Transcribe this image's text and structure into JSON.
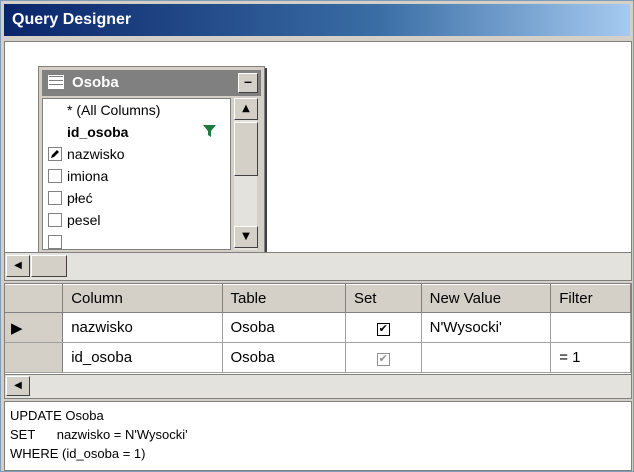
{
  "window": {
    "title": "Query Designer"
  },
  "diagram": {
    "table_name": "Osoba",
    "minimize_symbol": "–",
    "columns": [
      {
        "label": "* (All Columns)",
        "bold": false,
        "checked": false
      },
      {
        "label": "id_osoba",
        "bold": true,
        "checked": false,
        "filter": true
      },
      {
        "label": "nazwisko",
        "bold": false,
        "checked": true
      },
      {
        "label": "imiona",
        "bold": false,
        "checked": false
      },
      {
        "label": "płeć",
        "bold": false,
        "checked": false
      },
      {
        "label": "pesel",
        "bold": false,
        "checked": false
      }
    ],
    "icons": {
      "filter": "filter-icon",
      "scroll_up": "arrow-up-icon",
      "scroll_down": "arrow-down-icon",
      "scroll_left": "arrow-left-icon"
    }
  },
  "criteria": {
    "headers": [
      "Column",
      "Table",
      "Set",
      "New Value",
      "Filter"
    ],
    "rows": [
      {
        "indicator": "▶",
        "column": "nazwisko",
        "table": "Osoba",
        "set": true,
        "new_value": "N'Wysocki'",
        "filter": ""
      },
      {
        "indicator": "",
        "column": "id_osoba",
        "table": "Osoba",
        "set": true,
        "new_value": "",
        "filter": "= 1"
      }
    ]
  },
  "sql": {
    "line1": "UPDATE Osoba",
    "line2": "SET      nazwisko = N'Wysocki'",
    "line3": "WHERE (id_osoba = 1)"
  },
  "colors": {
    "title_start": "#0a246a",
    "title_end": "#a6caf0",
    "face": "#d4d0c8"
  }
}
